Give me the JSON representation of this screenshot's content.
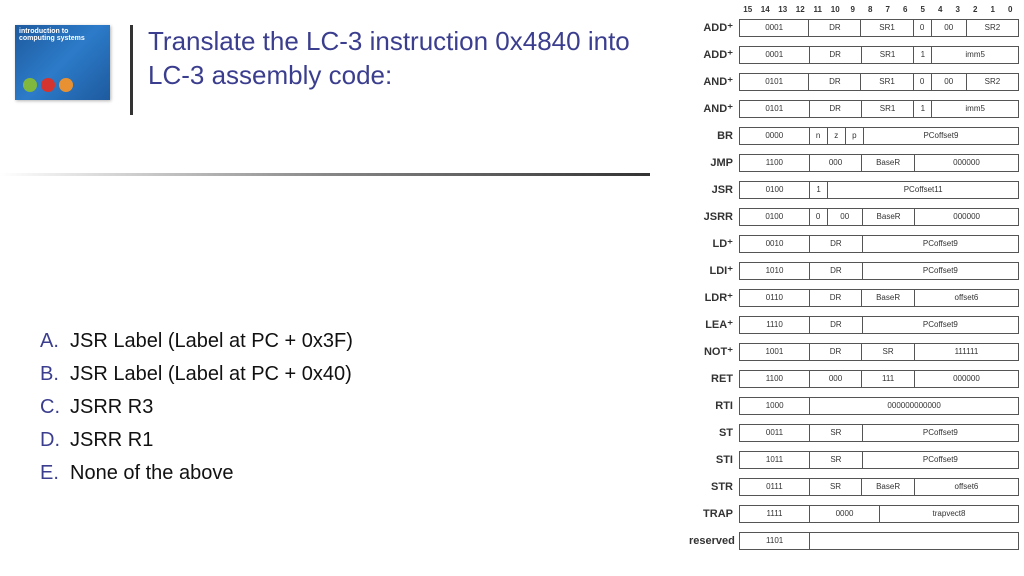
{
  "book": {
    "title_line1": "introduction to",
    "title_line2": "computing systems"
  },
  "question": {
    "title": "Translate the LC-3 instruction 0x4840 into LC-3 assembly code:"
  },
  "answers": [
    {
      "letter": "A.",
      "text": "JSR Label (Label at PC + 0x3F)"
    },
    {
      "letter": "B.",
      "text": "JSR Label (Label at PC + 0x40)"
    },
    {
      "letter": "C.",
      "text": "JSRR R3"
    },
    {
      "letter": "D.",
      "text": "JSRR R1"
    },
    {
      "letter": "E.",
      "text": "None of the above"
    }
  ],
  "bit_labels": [
    "15",
    "14",
    "13",
    "12",
    "11",
    "10",
    "9",
    "8",
    "7",
    "6",
    "5",
    "4",
    "3",
    "2",
    "1",
    "0"
  ],
  "instructions": [
    {
      "mn": "ADD⁺",
      "fields": [
        [
          "0001",
          "w4"
        ],
        [
          "DR",
          "w3"
        ],
        [
          "SR1",
          "w3"
        ],
        [
          "0",
          "w1"
        ],
        [
          "00",
          "w2"
        ],
        [
          "SR2",
          "w3"
        ]
      ]
    },
    {
      "mn": "ADD⁺",
      "fields": [
        [
          "0001",
          "w4"
        ],
        [
          "DR",
          "w3"
        ],
        [
          "SR1",
          "w3"
        ],
        [
          "1",
          "w1"
        ],
        [
          "imm5",
          "w5"
        ]
      ]
    },
    {
      "mn": "AND⁺",
      "fields": [
        [
          "0101",
          "w4"
        ],
        [
          "DR",
          "w3"
        ],
        [
          "SR1",
          "w3"
        ],
        [
          "0",
          "w1"
        ],
        [
          "00",
          "w2"
        ],
        [
          "SR2",
          "w3"
        ]
      ]
    },
    {
      "mn": "AND⁺",
      "fields": [
        [
          "0101",
          "w4"
        ],
        [
          "DR",
          "w3"
        ],
        [
          "SR1",
          "w3"
        ],
        [
          "1",
          "w1"
        ],
        [
          "imm5",
          "w5"
        ]
      ]
    },
    {
      "mn": "BR",
      "fields": [
        [
          "0000",
          "w4"
        ],
        [
          "n",
          "w1"
        ],
        [
          "z",
          "w1"
        ],
        [
          "p",
          "w1"
        ],
        [
          "PCoffset9",
          "w9"
        ]
      ]
    },
    {
      "mn": "JMP",
      "fields": [
        [
          "1100",
          "w4"
        ],
        [
          "000",
          "w3"
        ],
        [
          "BaseR",
          "w3"
        ],
        [
          "000000",
          "w6"
        ]
      ]
    },
    {
      "mn": "JSR",
      "fields": [
        [
          "0100",
          "w4"
        ],
        [
          "1",
          "w1"
        ],
        [
          "PCoffset11",
          "w11"
        ]
      ]
    },
    {
      "mn": "JSRR",
      "fields": [
        [
          "0100",
          "w4"
        ],
        [
          "0",
          "w1"
        ],
        [
          "00",
          "w2"
        ],
        [
          "BaseR",
          "w3"
        ],
        [
          "000000",
          "w6"
        ]
      ]
    },
    {
      "mn": "LD⁺",
      "fields": [
        [
          "0010",
          "w4"
        ],
        [
          "DR",
          "w3"
        ],
        [
          "PCoffset9",
          "w9"
        ]
      ]
    },
    {
      "mn": "LDI⁺",
      "fields": [
        [
          "1010",
          "w4"
        ],
        [
          "DR",
          "w3"
        ],
        [
          "PCoffset9",
          "w9"
        ]
      ]
    },
    {
      "mn": "LDR⁺",
      "fields": [
        [
          "0110",
          "w4"
        ],
        [
          "DR",
          "w3"
        ],
        [
          "BaseR",
          "w3"
        ],
        [
          "offset6",
          "w6"
        ]
      ]
    },
    {
      "mn": "LEA⁺",
      "fields": [
        [
          "1110",
          "w4"
        ],
        [
          "DR",
          "w3"
        ],
        [
          "PCoffset9",
          "w9"
        ]
      ]
    },
    {
      "mn": "NOT⁺",
      "fields": [
        [
          "1001",
          "w4"
        ],
        [
          "DR",
          "w3"
        ],
        [
          "SR",
          "w3"
        ],
        [
          "111111",
          "w6"
        ]
      ]
    },
    {
      "mn": "RET",
      "fields": [
        [
          "1100",
          "w4"
        ],
        [
          "000",
          "w3"
        ],
        [
          "111",
          "w3"
        ],
        [
          "000000",
          "w6"
        ]
      ]
    },
    {
      "mn": "RTI",
      "fields": [
        [
          "1000",
          "w4"
        ],
        [
          "000000000000",
          "w12"
        ]
      ]
    },
    {
      "mn": "ST",
      "fields": [
        [
          "0011",
          "w4"
        ],
        [
          "SR",
          "w3"
        ],
        [
          "PCoffset9",
          "w9"
        ]
      ]
    },
    {
      "mn": "STI",
      "fields": [
        [
          "1011",
          "w4"
        ],
        [
          "SR",
          "w3"
        ],
        [
          "PCoffset9",
          "w9"
        ]
      ]
    },
    {
      "mn": "STR",
      "fields": [
        [
          "0111",
          "w4"
        ],
        [
          "SR",
          "w3"
        ],
        [
          "BaseR",
          "w3"
        ],
        [
          "offset6",
          "w6"
        ]
      ]
    },
    {
      "mn": "TRAP",
      "fields": [
        [
          "1111",
          "w4"
        ],
        [
          "0000",
          "w4"
        ],
        [
          "trapvect8",
          "w8"
        ]
      ]
    },
    {
      "mn": "reserved",
      "fields": [
        [
          "1101",
          "w4"
        ],
        [
          "",
          "w12"
        ]
      ]
    }
  ]
}
